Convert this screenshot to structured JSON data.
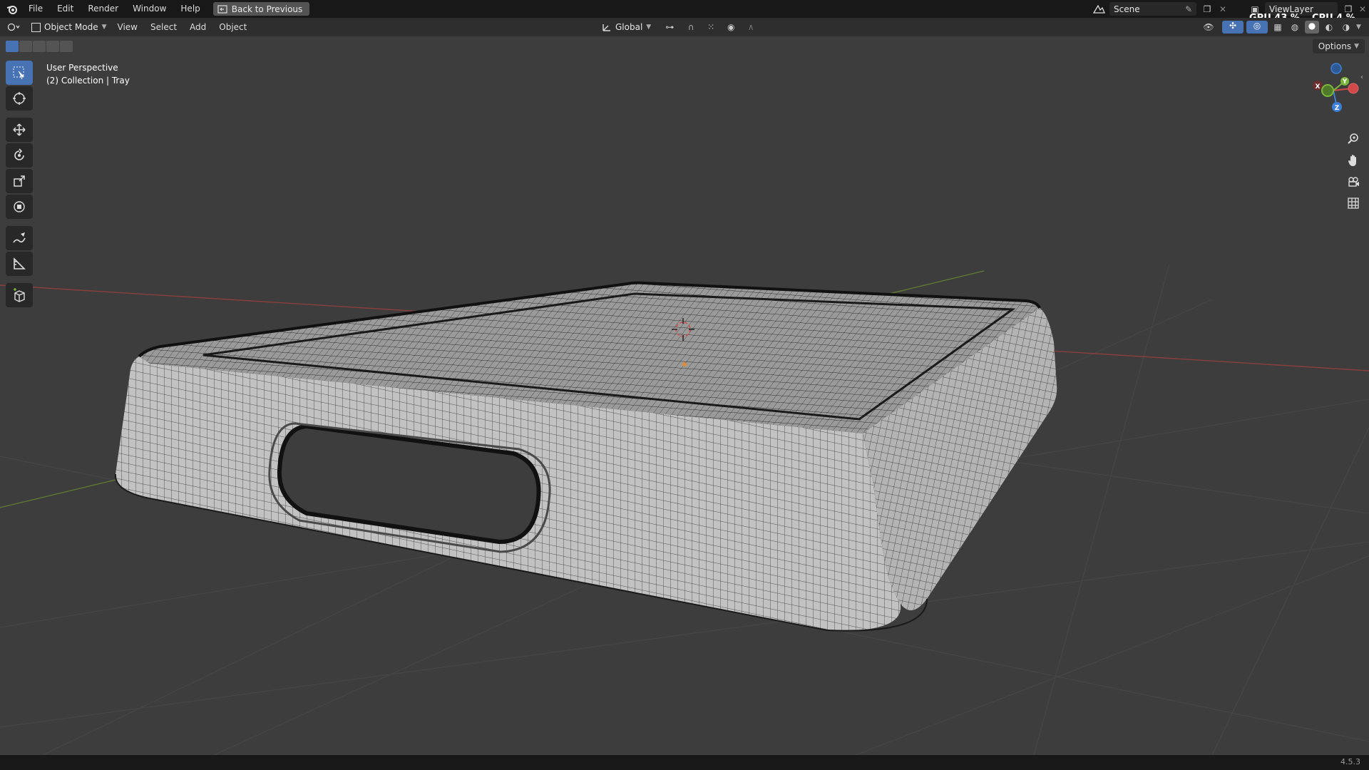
{
  "menubar": {
    "items": [
      "File",
      "Edit",
      "Render",
      "Window",
      "Help"
    ],
    "back_button": "Back to Previous",
    "scene": "Scene",
    "view_layer": "ViewLayer",
    "gpu": "GPU 43 %",
    "cpu": "CPU 4 %"
  },
  "header": {
    "mode": "Object Mode",
    "menus": [
      "View",
      "Select",
      "Add",
      "Object"
    ],
    "orientation": "Global",
    "options": "Options"
  },
  "viewport": {
    "perspective": "User Perspective",
    "collection": "(2) Collection | Tray"
  },
  "gizmo": {
    "x": "X",
    "y": "Y",
    "z": "Z"
  },
  "status": {
    "version": "4.5.3"
  },
  "colors": {
    "accent": "#4772b3",
    "x_axis": "#d14949",
    "y_axis": "#7ab83a",
    "z_axis": "#3b7fd6"
  }
}
